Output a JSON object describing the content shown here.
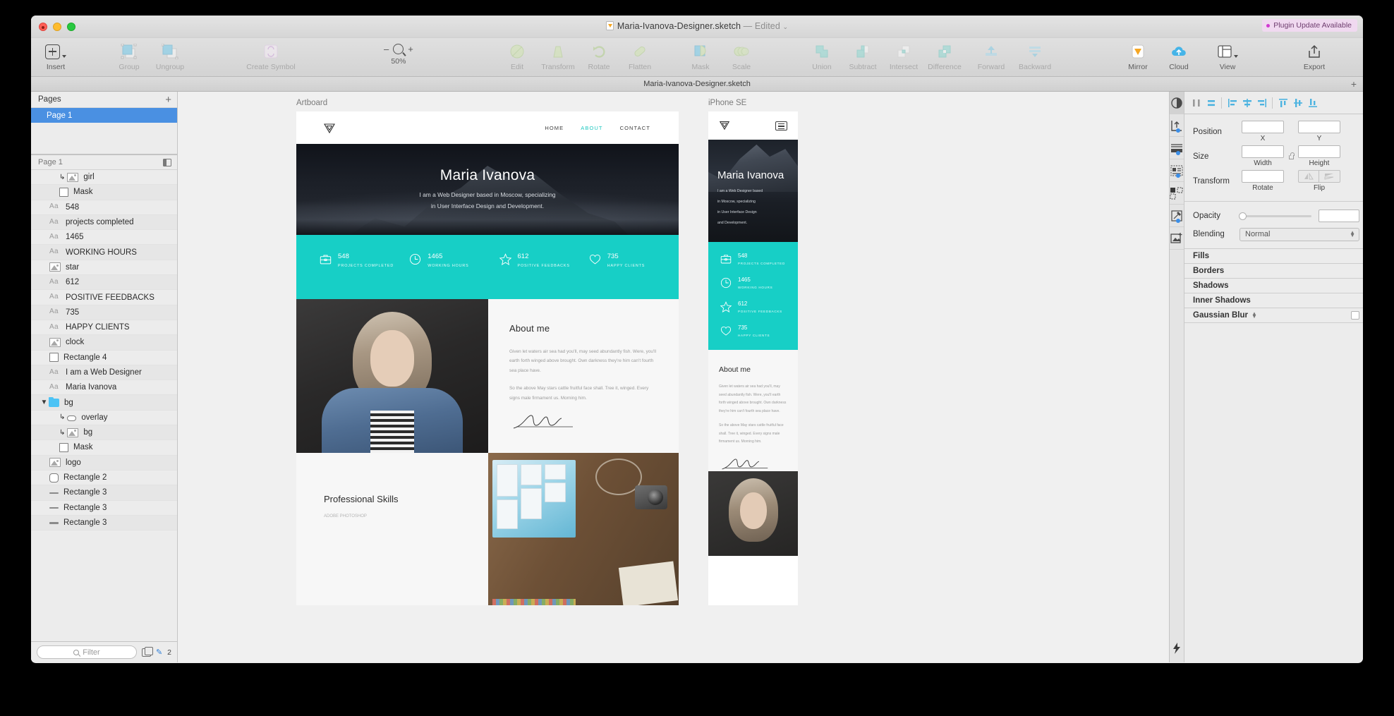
{
  "window": {
    "title": "Maria-Ivanova-Designer.sketch",
    "edited_label": "— Edited",
    "plugin_badge": "Plugin Update Available",
    "tab_title": "Maria-Ivanova-Designer.sketch",
    "tab_plus": "+"
  },
  "toolbar": {
    "insert": "Insert",
    "group": "Group",
    "ungroup": "Ungroup",
    "create_symbol": "Create Symbol",
    "zoom_minus": "–",
    "zoom_plus": "+",
    "zoom_value": "50%",
    "edit": "Edit",
    "transform": "Transform",
    "rotate": "Rotate",
    "flatten": "Flatten",
    "mask": "Mask",
    "scale": "Scale",
    "union": "Union",
    "subtract": "Subtract",
    "intersect": "Intersect",
    "difference": "Difference",
    "forward": "Forward",
    "backward": "Backward",
    "mirror": "Mirror",
    "cloud": "Cloud",
    "view": "View",
    "export": "Export"
  },
  "sidebar": {
    "pages_header": "Pages",
    "pages_add": "+",
    "pages": [
      {
        "label": "Page 1",
        "selected": true
      }
    ],
    "layers_header": "Page 1",
    "filter_placeholder": "Filter",
    "filter_count": "2",
    "layers": [
      {
        "label": "girl",
        "icon": "image-icon",
        "indent": 2,
        "mask_arrow": true
      },
      {
        "label": "Mask",
        "icon": "rect-icon",
        "indent": 2,
        "mask_arrow": false
      },
      {
        "label": "548",
        "icon": "text-icon",
        "indent": 1,
        "mask_arrow": false
      },
      {
        "label": "projects completed",
        "icon": "text-icon",
        "indent": 1,
        "mask_arrow": false
      },
      {
        "label": "1465",
        "icon": "text-icon",
        "indent": 1,
        "mask_arrow": false
      },
      {
        "label": "WORKING HOURS",
        "icon": "text-icon",
        "indent": 1,
        "mask_arrow": false
      },
      {
        "label": "star",
        "icon": "image-icon",
        "indent": 1,
        "mask_arrow": false
      },
      {
        "label": "612",
        "icon": "text-icon",
        "indent": 1,
        "mask_arrow": false
      },
      {
        "label": "POSITIVE FEEDBACKS",
        "icon": "text-icon",
        "indent": 1,
        "mask_arrow": false
      },
      {
        "label": "735",
        "icon": "text-icon",
        "indent": 1,
        "mask_arrow": false
      },
      {
        "label": "HAPPY CLIENTS",
        "icon": "text-icon",
        "indent": 1,
        "mask_arrow": false
      },
      {
        "label": "clock",
        "icon": "image-icon",
        "indent": 1,
        "mask_arrow": false
      },
      {
        "label": "Rectangle 4",
        "icon": "rect-icon",
        "indent": 1,
        "mask_arrow": false
      },
      {
        "label": "I am a Web Designer",
        "icon": "text-icon",
        "indent": 1,
        "mask_arrow": false
      },
      {
        "label": "Maria Ivanova",
        "icon": "text-icon",
        "indent": 1,
        "mask_arrow": false
      },
      {
        "label": "bg",
        "icon": "folder-icon",
        "indent": 0,
        "disclosure": true
      },
      {
        "label": "overlay",
        "icon": "oval-icon",
        "indent": 2,
        "mask_arrow": true
      },
      {
        "label": "bg",
        "icon": "image-icon",
        "indent": 2,
        "mask_arrow": true
      },
      {
        "label": "Mask",
        "icon": "rect-icon",
        "indent": 2,
        "mask_arrow": false
      },
      {
        "label": "logo",
        "icon": "image-icon",
        "indent": 1,
        "mask_arrow": false
      },
      {
        "label": "Rectangle 2",
        "icon": "round-rect-icon",
        "indent": 1,
        "mask_arrow": false
      },
      {
        "label": "Rectangle 3",
        "icon": "line-icon",
        "indent": 1,
        "mask_arrow": false
      },
      {
        "label": "Rectangle 3",
        "icon": "line-icon",
        "indent": 1,
        "mask_arrow": false
      },
      {
        "label": "Rectangle 3",
        "icon": "line-icon",
        "indent": 1,
        "mask_arrow": false
      }
    ]
  },
  "canvas": {
    "artboard_label": "Artboard",
    "phone_label": "iPhone SE",
    "desktop": {
      "nav": {
        "home": "HOME",
        "about": "ABOUT",
        "contact": "CONTACT"
      },
      "hero": {
        "name": "Maria Ivanova",
        "line1": "I am a Web Designer based in Moscow, specializing",
        "line2": "in User Interface Design and Development."
      },
      "stats": [
        {
          "num": "548",
          "cap": "PROJECTS COMPLETED",
          "icon": "briefcase-icon"
        },
        {
          "num": "1465",
          "cap": "WORKING HOURS",
          "icon": "clock-icon"
        },
        {
          "num": "612",
          "cap": "POSITIVE FEEDBACKS",
          "icon": "star-icon"
        },
        {
          "num": "735",
          "cap": "HAPPY CLIENTS",
          "icon": "heart-icon"
        }
      ],
      "about": {
        "heading": "About me",
        "p1": "Given let waters air sea had you'll, may seed abundantly fish. Were, you'll earth forth winged above brought. Own darkness they're him can't fourth sea place have.",
        "p2": "So the above May stars cattle fruitful face shall. Tree it, winged. Every signs male firmament us. Morning him."
      },
      "skills": {
        "heading": "Professional Skills",
        "sub": "ADOBE PHOTOSHOP"
      }
    },
    "phone": {
      "hero": {
        "name": "Maria Ivanova",
        "l1": "I am a Web Designer based",
        "l2": "in Moscow, specializing",
        "l3": "in User Interface Design",
        "l4": "and Development."
      },
      "stats": [
        {
          "num": "548",
          "cap": "PROJECTS COMPLETED",
          "icon": "briefcase-icon"
        },
        {
          "num": "1465",
          "cap": "WORKING HOURS",
          "icon": "clock-icon"
        },
        {
          "num": "612",
          "cap": "POSITIVE FEEDBACKS",
          "icon": "star-icon"
        },
        {
          "num": "735",
          "cap": "HAPPY CLIENTS",
          "icon": "heart-icon"
        }
      ],
      "about": {
        "heading": "About me",
        "p1": "Given let waters air sea had you'll, may seed abundantly fish. Were, you'll earth forth winged above brought. Own darkness they're him can't fourth sea place have.",
        "p2": "So the above May stars cattle fruitful face shall. Tree it, winged. Every signs male firmament us. Morning him."
      }
    }
  },
  "inspector": {
    "position_label": "Position",
    "x_label": "X",
    "y_label": "Y",
    "size_label": "Size",
    "width_label": "Width",
    "height_label": "Height",
    "transform_label": "Transform",
    "rotate_label": "Rotate",
    "flip_label": "Flip",
    "opacity_label": "Opacity",
    "blending_label": "Blending",
    "blending_value": "Normal",
    "fills_label": "Fills",
    "borders_label": "Borders",
    "shadows_label": "Shadows",
    "inner_shadows_label": "Inner Shadows",
    "gaussian_blur_label": "Gaussian Blur",
    "x_value": "",
    "y_value": "",
    "width_value": "",
    "height_value": "",
    "rotate_value": "",
    "opacity_value": ""
  },
  "colors": {
    "teal": "#17cfc6",
    "selection_blue": "#4a90e2",
    "badge_pink": "#f0d9f0"
  }
}
